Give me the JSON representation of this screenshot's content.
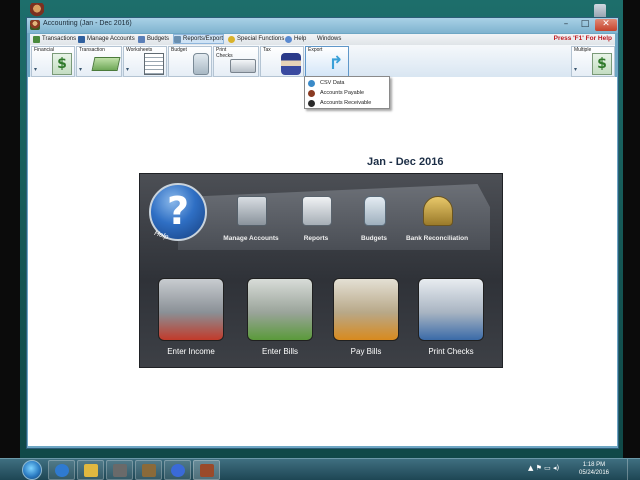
{
  "window": {
    "title": "Accounting (Jan - Dec 2016)",
    "controls": {
      "minimize": "–",
      "maximize": "□",
      "close": "✕"
    }
  },
  "menubar": {
    "items": [
      {
        "label": "Transactions",
        "icon": "transactions-icon",
        "color": "#4a8a3c"
      },
      {
        "label": "Manage Accounts",
        "icon": "manage-accounts-icon",
        "color": "#2e5f9e"
      },
      {
        "label": "Budgets",
        "icon": "budgets-icon",
        "color": "#5a7fb8"
      },
      {
        "label": "Reports/Export",
        "icon": "reports-export-icon",
        "color": "#6a8fb0",
        "active": true
      },
      {
        "label": "Special Functions",
        "icon": "special-functions-icon",
        "color": "#d8b22a"
      },
      {
        "label": "Help",
        "icon": "help-icon",
        "color": "#5a8ad0"
      },
      {
        "label": "Windows",
        "icon": "",
        "color": ""
      }
    ],
    "help_hint": "Press 'F1' For Help"
  },
  "toolbar": {
    "buttons": [
      {
        "label": "Financial",
        "icon": "dollar-icon"
      },
      {
        "label": "Transaction",
        "icon": "money-stack-icon"
      },
      {
        "label": "Worksheets",
        "icon": "worksheet-icon"
      },
      {
        "label": "Budget",
        "icon": "budget-jar-icon"
      },
      {
        "label": "Print Checks",
        "icon": "printer-icon"
      },
      {
        "label": "Tax",
        "icon": "uncle-sam-icon"
      },
      {
        "label": "Export",
        "icon": "export-arrow-icon",
        "active": true
      },
      {
        "label": "Multiple",
        "icon": "multiple-dollar-icon"
      }
    ]
  },
  "export_menu": {
    "items": [
      {
        "label": "CSV Data",
        "icon": "csv-arrow-icon",
        "color": "#3a8ac8"
      },
      {
        "label": "Accounts Payable",
        "icon": "accounts-payable-icon",
        "color": "#8a3a22"
      },
      {
        "label": "Accounts Receivable",
        "icon": "accounts-receivable-icon",
        "color": "#2a2a2a"
      }
    ]
  },
  "main": {
    "period": "Jan - Dec 2016",
    "help_label": "Help",
    "top_items": [
      {
        "label": "Manage Accounts",
        "icon": "manage-accounts-icon"
      },
      {
        "label": "Reports",
        "icon": "printer-icon"
      },
      {
        "label": "Budgets",
        "icon": "budget-jar-icon"
      },
      {
        "label": "Bank Reconciliation",
        "icon": "scales-icon"
      }
    ],
    "tiles": [
      {
        "label": "Enter Income",
        "icon": "calculator-money-icon",
        "color": "#c23a2a"
      },
      {
        "label": "Enter Bills",
        "icon": "bills-calculator-icon",
        "color": "#5a9a3a"
      },
      {
        "label": "Pay Bills",
        "icon": "bills-money-icon",
        "color": "#d88a1e"
      },
      {
        "label": "Print Checks",
        "icon": "printer-icon",
        "color": "#3a6aa8"
      }
    ]
  },
  "taskbar": {
    "apps": [
      {
        "icon": "internet-explorer-icon",
        "color": "#2f7ad0"
      },
      {
        "icon": "file-explorer-icon",
        "color": "#e0b840"
      },
      {
        "icon": "app-grey-icon",
        "color": "#6a6a6a"
      },
      {
        "icon": "app-money-icon",
        "color": "#8a6a3a"
      },
      {
        "icon": "snowflake-app-icon",
        "color": "#3a6ad8"
      },
      {
        "icon": "accounting-app-icon",
        "color": "#9a4a2a"
      }
    ],
    "tray": "▲  ⚑  ▭  ◂)",
    "time": "1:18 PM",
    "date": "05/24/2016"
  }
}
